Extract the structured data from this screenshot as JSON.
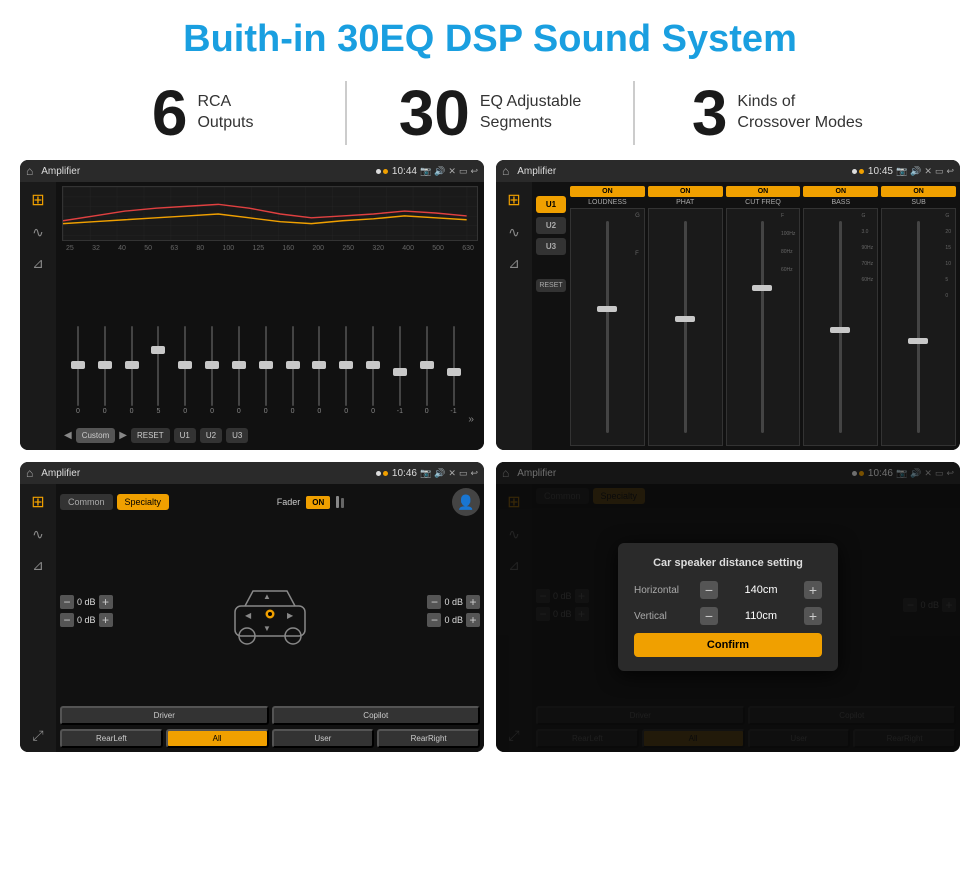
{
  "page": {
    "title": "Buith-in 30EQ DSP Sound System",
    "stats": [
      {
        "number": "6",
        "label_line1": "RCA",
        "label_line2": "Outputs"
      },
      {
        "number": "30",
        "label_line1": "EQ Adjustable",
        "label_line2": "Segments"
      },
      {
        "number": "3",
        "label_line1": "Kinds of",
        "label_line2": "Crossover Modes"
      }
    ]
  },
  "screens": {
    "top_left": {
      "status_bar": {
        "title": "Amplifier",
        "time": "10:44"
      },
      "eq_labels": [
        "25",
        "32",
        "40",
        "50",
        "63",
        "80",
        "100",
        "125",
        "160",
        "200",
        "250",
        "320",
        "400",
        "500",
        "630"
      ],
      "slider_values": [
        "0",
        "0",
        "0",
        "5",
        "0",
        "0",
        "0",
        "0",
        "0",
        "0",
        "0",
        "0",
        "-1",
        "0",
        "-1"
      ],
      "bottom_buttons": [
        "Custom",
        "RESET",
        "U1",
        "U2",
        "U3"
      ]
    },
    "top_right": {
      "status_bar": {
        "title": "Amplifier",
        "time": "10:45"
      },
      "presets": [
        "U1",
        "U2",
        "U3"
      ],
      "channels": [
        {
          "name": "LOUDNESS",
          "on": true
        },
        {
          "name": "PHAT",
          "on": true
        },
        {
          "name": "CUT FREQ",
          "on": true
        },
        {
          "name": "BASS",
          "on": true
        },
        {
          "name": "SUB",
          "on": true
        }
      ]
    },
    "bottom_left": {
      "status_bar": {
        "title": "Amplifier",
        "time": "10:46"
      },
      "tabs": [
        "Common",
        "Specialty"
      ],
      "fader_label": "Fader",
      "fader_on": "ON",
      "db_values": [
        "0 dB",
        "0 dB",
        "0 dB",
        "0 dB"
      ],
      "buttons": [
        "Driver",
        "Copilot",
        "RearLeft",
        "All",
        "User",
        "RearRight"
      ]
    },
    "bottom_right": {
      "status_bar": {
        "title": "Amplifier",
        "time": "10:46"
      },
      "tabs": [
        "Common",
        "Specialty"
      ],
      "dialog": {
        "title": "Car speaker distance setting",
        "horizontal_label": "Horizontal",
        "horizontal_value": "140cm",
        "vertical_label": "Vertical",
        "vertical_value": "110cm",
        "confirm_label": "Confirm"
      },
      "db_values": [
        "0 dB",
        "0 dB"
      ],
      "buttons": [
        "Driver",
        "Copilot",
        "RearLeft",
        "All",
        "User",
        "RearRight"
      ]
    }
  },
  "icons": {
    "home": "⌂",
    "settings": "≡",
    "location": "♦",
    "camera": "📷",
    "volume": "🔊",
    "back": "↩",
    "play": "▶",
    "pause": "⏸",
    "prev": "◀",
    "next": "▶",
    "expand": "»",
    "waveform": "∿",
    "speaker": "⊿",
    "eq_icon": "⊞",
    "fader_icon": "⊟",
    "expand_arrows": "⤢"
  }
}
